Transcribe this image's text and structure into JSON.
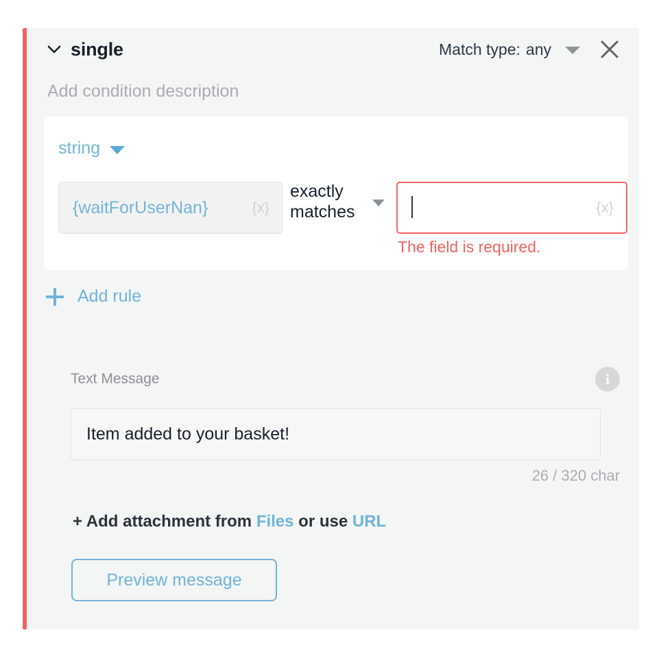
{
  "card": {
    "accent_color": "#f4635f",
    "background": "#f4f5f5"
  },
  "header": {
    "chevron_icon": "chevron-down-icon",
    "title": "single",
    "match_type_label": "Match type:",
    "match_type_value": "any",
    "match_type_caret_icon": "caret-down-icon",
    "close_icon": "close-icon"
  },
  "description": {
    "placeholder": "Add condition description"
  },
  "rules_panel": {
    "type_select": {
      "value": "string",
      "caret_icon": "caret-down-icon",
      "color": "#74b4d8"
    },
    "rule": {
      "variable_value": "{waitForUserNan}",
      "variable_token_icon": "{x}",
      "operator": "exactly matches",
      "operator_caret_icon": "caret-down-icon",
      "value_input": "",
      "value_input_token_icon": "{x}",
      "error_message": "The field is required.",
      "error_color": "#f4635f"
    }
  },
  "add_rule": {
    "plus_icon": "plus-icon",
    "label": "Add rule",
    "color": "#6fb3dc"
  },
  "message_section": {
    "label": "Text Message",
    "info_icon": "info-icon",
    "info_glyph": "i",
    "message_value": "Item added to your basket!",
    "char_counter": "26 / 320 char",
    "attachment": {
      "prefix": "+ Add attachment from ",
      "files_link": "Files",
      "middle": " or use ",
      "url_link": "URL"
    },
    "preview_button": "Preview message"
  }
}
